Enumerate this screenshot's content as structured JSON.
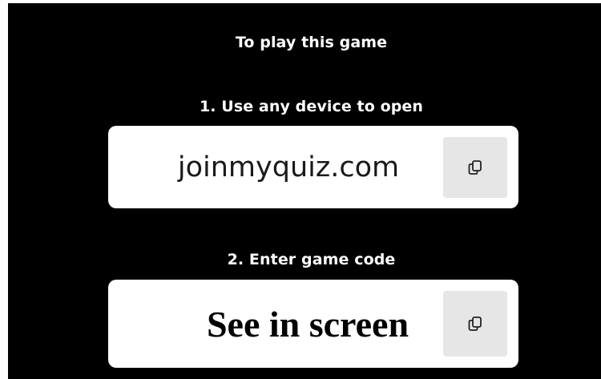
{
  "instructions": {
    "title": "To play this game",
    "step1": "1. Use any device to open",
    "step2": "2. Enter game code"
  },
  "join_url": {
    "value": "joinmyquiz.com",
    "copy_icon": "copy-icon"
  },
  "game_code": {
    "value": "See in screen",
    "copy_icon": "copy-icon"
  },
  "colors": {
    "panel_background": "#000000",
    "card_background": "#ffffff",
    "copy_button_background": "#e6e6e6"
  }
}
